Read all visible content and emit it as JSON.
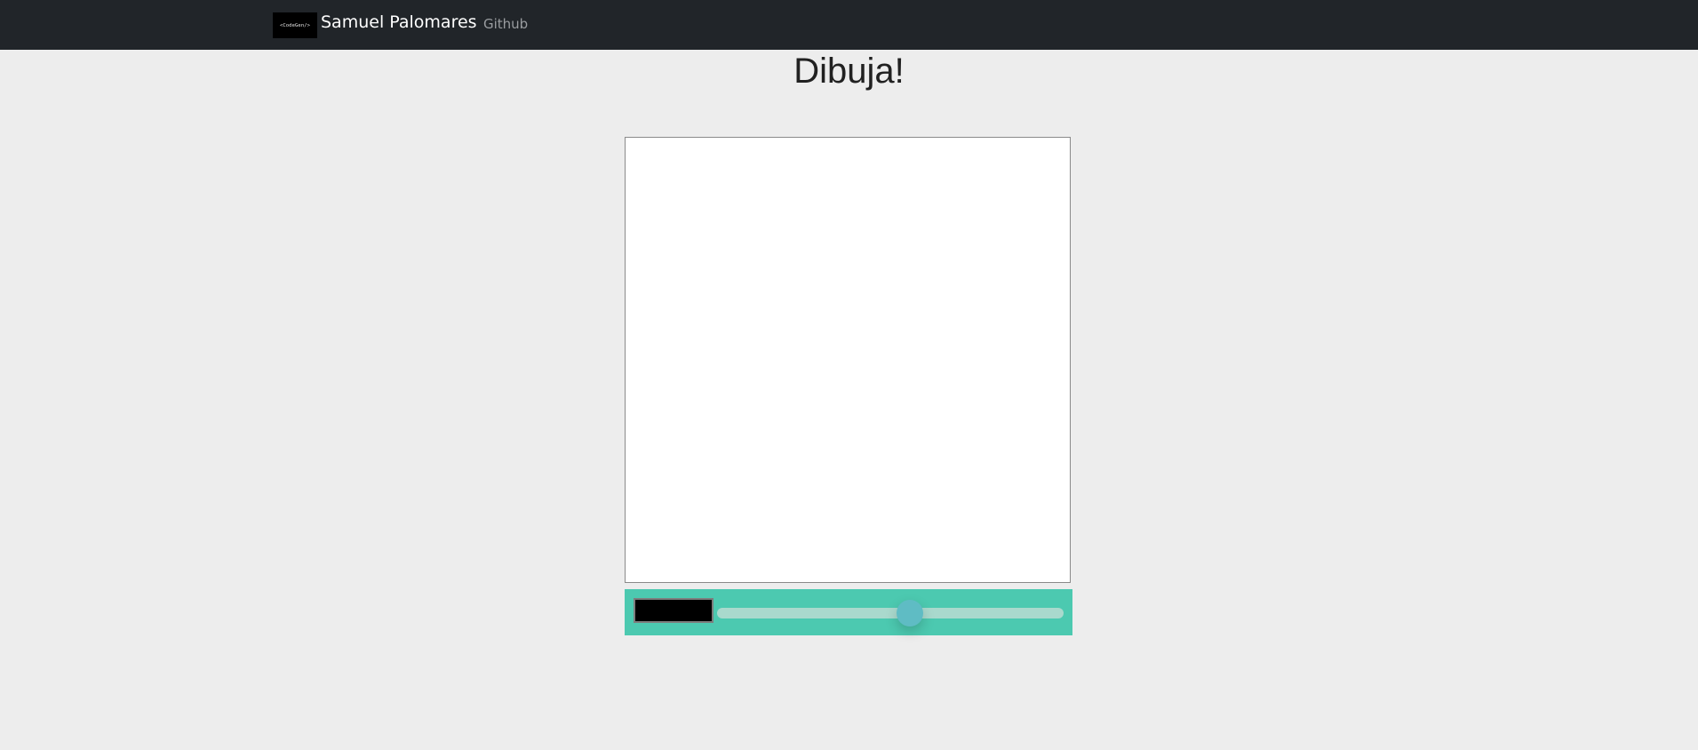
{
  "navbar": {
    "logo_text": "<CodeGen/>",
    "brand_name": "Samuel Palomares",
    "links": [
      {
        "label": "Github"
      }
    ],
    "background": "#212529"
  },
  "main": {
    "title": "Dibuja!"
  },
  "toolbar": {
    "background": "#4cc9b0",
    "brush_color": "#000000",
    "brush_size_fraction": 0.56
  }
}
